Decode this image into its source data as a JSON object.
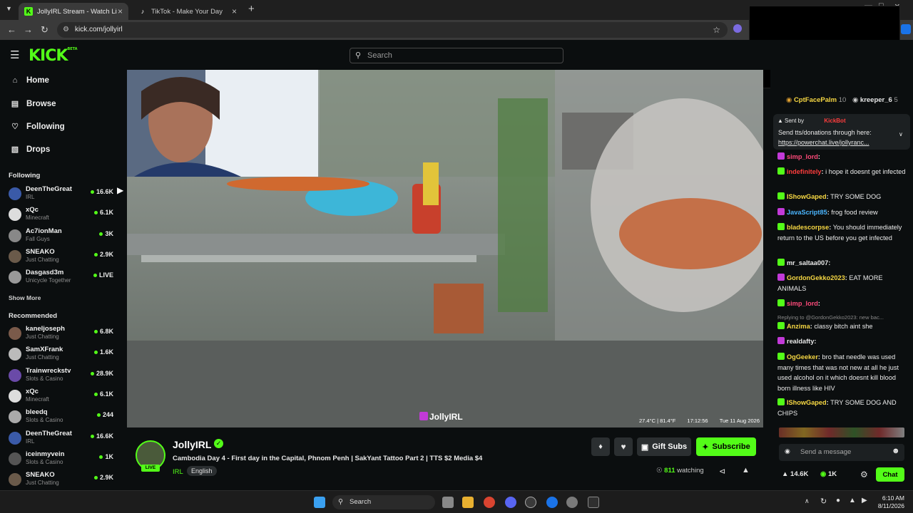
{
  "browser": {
    "tabs": [
      {
        "title": "JollyIRL Stream - Watch Live",
        "favicon": "kick-icon",
        "active": true
      },
      {
        "title": "TikTok - Make Your Day",
        "favicon": "tiktok-icon",
        "active": false
      }
    ],
    "url": "kick.com/jollyirl"
  },
  "header": {
    "logo": "KICK",
    "logo_tag": "BETA",
    "search_placeholder": "Search"
  },
  "sidebar": {
    "nav": [
      {
        "label": "Home",
        "icon": "home-icon"
      },
      {
        "label": "Browse",
        "icon": "browse-icon"
      },
      {
        "label": "Following",
        "icon": "heart-icon"
      },
      {
        "label": "Drops",
        "icon": "drops-icon"
      }
    ],
    "following_title": "Following",
    "following": [
      {
        "name": "DeenTheGreat",
        "category": "IRL",
        "viewers": "16.6K"
      },
      {
        "name": "xQc",
        "category": "Minecraft",
        "viewers": "6.1K"
      },
      {
        "name": "Ac7ionMan",
        "category": "Fall Guys",
        "viewers": "3K"
      },
      {
        "name": "SNEAKO",
        "category": "Just Chatting",
        "viewers": "2.9K"
      },
      {
        "name": "Dasgasd3m",
        "category": "Unicycle Together",
        "viewers": "LIVE"
      }
    ],
    "show_more": "Show More",
    "recommended_title": "Recommended",
    "recommended": [
      {
        "name": "kaneljoseph",
        "category": "Just Chatting",
        "viewers": "6.8K"
      },
      {
        "name": "SamXFrank",
        "category": "Just Chatting",
        "viewers": "1.6K"
      },
      {
        "name": "Trainwreckstv",
        "category": "Slots & Casino",
        "viewers": "28.9K"
      },
      {
        "name": "xQc",
        "category": "Minecraft",
        "viewers": "6.1K"
      },
      {
        "name": "bleedq",
        "category": "Slots & Casino",
        "viewers": "244"
      },
      {
        "name": "DeenTheGreat",
        "category": "IRL",
        "viewers": "16.6K"
      },
      {
        "name": "iceinmyvein",
        "category": "Slots & Casino",
        "viewers": "1K"
      },
      {
        "name": "SNEAKO",
        "category": "Just Chatting",
        "viewers": "2.9K"
      }
    ]
  },
  "video": {
    "watermark": "JollyIRL",
    "overlay_weather": "27.4°C | 81.4°F",
    "overlay_time": "17:12:56",
    "overlay_date": "Tue 11 Aug 2026"
  },
  "stream": {
    "streamer": "JollyIRL",
    "live_badge": "LIVE",
    "title": "Cambodia Day 4 - First day in the Capital, Phnom Penh | SakYant Tattoo Part 2 | TTS $2 Media $4",
    "category": "IRL",
    "tag": "English",
    "viewers": "811",
    "viewers_label": "watching",
    "gift_subs_label": "Gift Subs",
    "subscribe_label": "Subscribe"
  },
  "chat": {
    "top_gifters": [
      {
        "name": "CptFacePalm",
        "count": "10"
      },
      {
        "name": "kreeper_6",
        "count": "5"
      }
    ],
    "pinned": {
      "sent_by_label": "Sent by",
      "sender": "KickBot",
      "text": "Send tts/donations through here:",
      "link": "https://powerchat.live/jollyranc..."
    },
    "messages": [
      {
        "user": "simp_lord",
        "text": "",
        "color": "#ff4a7a"
      },
      {
        "user": "indefinitely",
        "text": "i hope it doesnt get infected",
        "color": "#ff3d3d"
      },
      {
        "user": "IShowGaped",
        "text": "TRY SOME DOG",
        "color": "#f6d743"
      },
      {
        "user": "JavaScript85",
        "text": "frog food review",
        "color": "#4bb6ff"
      },
      {
        "user": "bladescorpse",
        "text": "You should immediately return to the US before you get infected",
        "color": "#f6d743"
      },
      {
        "user": "mr_saltaa007",
        "text": "",
        "color": "#e8e8e8"
      },
      {
        "user": "GordonGekko2023",
        "text": "EAT MORE ANIMALS",
        "color": "#f6d743"
      },
      {
        "user": "simp_lord",
        "text": "",
        "color": "#ff4a7a"
      },
      {
        "user": "Anzima",
        "text": "classy bitch aint she",
        "color": "#f6d743",
        "reply": "Replying to @GordonGekko2023: new bac..."
      },
      {
        "user": "realdafty",
        "text": "",
        "color": "#e8e8e8"
      },
      {
        "user": "OgGeeker",
        "text": "bro that needle was used many times that was not new at all he just used alcohol on it which doesnt kill blood born illness like HIV",
        "color": "#f6d743"
      },
      {
        "user": "IShowGaped",
        "text": "TRY SOME DOG AND CHIPS",
        "color": "#f6d743"
      }
    ],
    "input_placeholder": "Send a message",
    "stats": {
      "likes": "14.6K",
      "kicks": "1K"
    },
    "chat_button": "Chat"
  },
  "taskbar": {
    "search_label": "Search",
    "time": "6:10 AM",
    "date": "8/11/2026"
  }
}
